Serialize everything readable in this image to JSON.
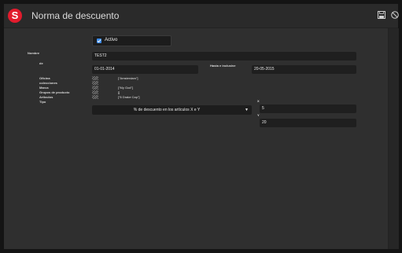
{
  "app": {
    "title": "Norma de descuento",
    "logo_letter": "S"
  },
  "toolbar": {
    "save_icon": "save-icon",
    "cancel_icon": "cancel-icon"
  },
  "form": {
    "activo_label": "Activo",
    "activo_checked": true,
    "nombre_label": "Nombre",
    "nombre_value": "TEST2",
    "de_label": "de",
    "de_value": "01-01-2014",
    "hasta_label": "Hasta e inclusive",
    "hasta_value": "20-05-2015",
    "oficina_label": "Oficina",
    "colecciones_label": "colecciones",
    "marca_label": "Marca",
    "grupos_label": "Grupos de producto",
    "articulos_label": "Articulos",
    "tipo_label": "Tipo",
    "oficina_value": "[\"Amsterdam\"]",
    "marca_value": "[\"My God\"]",
    "grupos_value": "[]",
    "articulos_value": "[\"6 Drake Cap\"]",
    "tipo_value": "% de descuento en los artículos X e Y",
    "x_label": "X",
    "x_value": "5",
    "y_label": "Y",
    "y_value": "20"
  }
}
